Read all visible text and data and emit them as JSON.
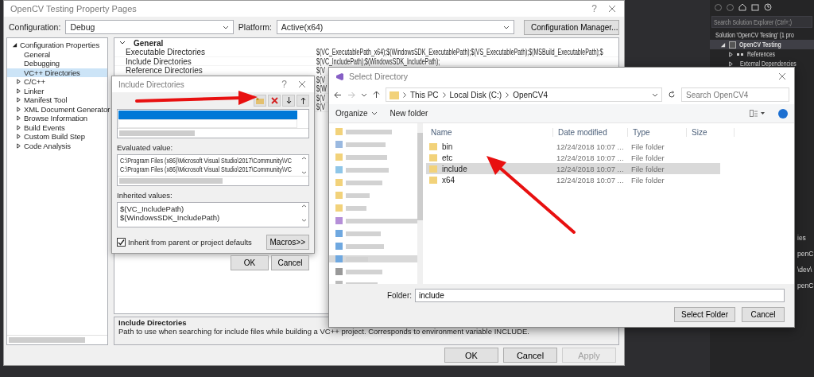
{
  "solution_explorer": {
    "search_placeholder": "Search Solution Explorer (Ctrl+;)",
    "tree": [
      {
        "label": "Solution 'OpenCV Testing' (1 pro",
        "kind": "solution",
        "children": [
          {
            "label": "OpenCV Testing",
            "kind": "project",
            "expanded": true,
            "children": [
              {
                "label": "References",
                "kind": "references",
                "expanded": false
              },
              {
                "label": "External Dependencies",
                "kind": "dependencies",
                "expanded": false
              }
            ]
          }
        ]
      }
    ],
    "fragments": [
      "ies",
      "penC",
      "\\dev\\",
      "penC"
    ]
  },
  "property_pages": {
    "title": "OpenCV Testing Property Pages",
    "help": "?",
    "configuration": {
      "label": "Configuration:",
      "value": "Debug"
    },
    "platform": {
      "label": "Platform:",
      "value": "Active(x64)"
    },
    "manager_button": "Configuration Manager...",
    "tree": {
      "label": "Configuration Properties",
      "expanded": true,
      "children": [
        {
          "label": "General",
          "kind": "leaf",
          "selected": false
        },
        {
          "label": "Debugging",
          "kind": "leaf",
          "selected": false
        },
        {
          "label": "VC++ Directories",
          "kind": "leaf",
          "selected": true
        },
        {
          "label": "C/C++",
          "kind": "group",
          "expanded": false,
          "selected": false
        },
        {
          "label": "Linker",
          "kind": "group",
          "expanded": false,
          "selected": false
        },
        {
          "label": "Manifest Tool",
          "kind": "group",
          "expanded": false,
          "selected": false
        },
        {
          "label": "XML Document Generator",
          "kind": "group",
          "expanded": false,
          "selected": false
        },
        {
          "label": "Browse Information",
          "kind": "group",
          "expanded": false,
          "selected": false
        },
        {
          "label": "Build Events",
          "kind": "group",
          "expanded": false,
          "selected": false
        },
        {
          "label": "Custom Build Step",
          "kind": "group",
          "expanded": false,
          "selected": false
        },
        {
          "label": "Code Analysis",
          "kind": "group",
          "expanded": false,
          "selected": false
        }
      ]
    },
    "grid": {
      "section": "General",
      "expanded": true,
      "rows": [
        {
          "name": "Executable Directories",
          "value": "$(VC_ExecutablePath_x64);$(WindowsSDK_ExecutablePath);$(VS_ExecutablePath);$(MSBuild_ExecutablePath);$"
        },
        {
          "name": "Include Directories",
          "value": "$(VC_IncludePath);$(WindowsSDK_IncludePath);"
        },
        {
          "name": "Reference Directories",
          "value": "$(V"
        },
        {
          "value": "$(V"
        },
        {
          "value": "$(W"
        },
        {
          "value": "$(V"
        },
        {
          "value": "$(V"
        }
      ]
    },
    "description": {
      "title": "Include Directories",
      "text": "Path to use when searching for include files while building a VC++ project.  Corresponds to environment variable INCLUDE."
    },
    "buttons": [
      {
        "label": "OK",
        "disabled": false
      },
      {
        "label": "Cancel",
        "disabled": false
      },
      {
        "label": "Apply",
        "disabled": true
      }
    ]
  },
  "include_dialog": {
    "title": "Include Directories",
    "help": "?",
    "entries": [
      {
        "selected": true
      },
      {
        "selected": false
      }
    ],
    "evaluated_label": "Evaluated value:",
    "evaluated_lines": [
      "C:\\Program Files (x86)\\Microsoft Visual Studio\\2017\\Community\\VC",
      "C:\\Program Files (x86)\\Microsoft Visual Studio\\2017\\Community\\VC"
    ],
    "inherited_label": "Inherited values:",
    "inherited_lines": [
      "$(VC_IncludePath)",
      "$(WindowsSDK_IncludePath)"
    ],
    "inherit_checkbox": {
      "label": "Inherit from parent or project defaults",
      "checked": true
    },
    "macros_button": "Macros>>",
    "buttons": [
      "OK",
      "Cancel"
    ]
  },
  "select_directory": {
    "title": "Select Directory",
    "breadcrumb": [
      "This PC",
      "Local Disk (C:)",
      "OpenCV4"
    ],
    "search_placeholder": "Search OpenCV4",
    "organize": "Organize",
    "new_folder": "New folder",
    "columns": [
      "Name",
      "Date modified",
      "Type",
      "Size"
    ],
    "files": [
      {
        "name": "bin",
        "date": "12/24/2018 10:07 ...",
        "type": "File folder",
        "selected": false
      },
      {
        "name": "etc",
        "date": "12/24/2018 10:07 ...",
        "type": "File folder",
        "selected": false
      },
      {
        "name": "include",
        "date": "12/24/2018 10:07 ...",
        "type": "File folder",
        "selected": true
      },
      {
        "name": "x64",
        "date": "12/24/2018 10:07 ...",
        "type": "File folder",
        "selected": false
      }
    ],
    "folder_label": "Folder:",
    "folder_value": "include",
    "buttons": [
      "Select Folder",
      "Cancel"
    ]
  }
}
